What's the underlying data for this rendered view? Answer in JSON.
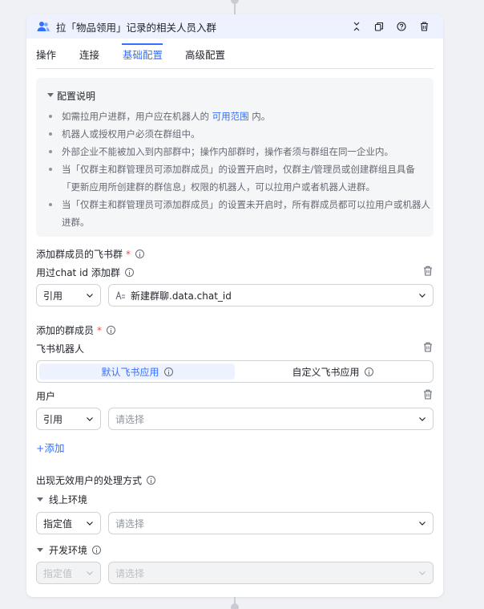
{
  "node": {
    "title": "拉「物品领用」记录的相关人员入群",
    "header_icons": [
      "collapse-icon",
      "copy-icon",
      "help-icon",
      "delete-icon"
    ]
  },
  "tabs": [
    {
      "label": "操作",
      "active": false
    },
    {
      "label": "连接",
      "active": false
    },
    {
      "label": "基础配置",
      "active": true
    },
    {
      "label": "高级配置",
      "active": false
    }
  ],
  "notes": {
    "title": "配置说明",
    "items": [
      {
        "text": "如需拉用户进群，用户应在机器人的 ",
        "link": "可用范围",
        "suffix": " 内。"
      },
      {
        "text": "机器人或授权用户必须在群组中。"
      },
      {
        "text": "外部企业不能被加入到内部群中；操作内部群时，操作者须与群组在同一企业内。"
      },
      {
        "text": "当「仅群主和群管理员可添加群成员」的设置开启时，仅群主/管理员或创建群组且具备「更新应用所创建群的群信息」权限的机器人，可以拉用户或者机器人进群。"
      },
      {
        "text": "当「仅群主和群管理员可添加群成员」的设置未开启时，所有群成员都可以拉用户或机器人进群。"
      }
    ]
  },
  "target_group": {
    "label": "添加群成员的飞书群",
    "required": "*",
    "sub_label": "用过chat id 添加群",
    "mode": "引用",
    "value_icon": "text-variable-icon",
    "value": "新建群聊.data.chat_id"
  },
  "members": {
    "label": "添加的群成员",
    "required": "*",
    "bot": {
      "label": "飞书机器人",
      "options": [
        "默认飞书应用",
        "自定义飞书应用"
      ],
      "selected": "默认飞书应用"
    },
    "user": {
      "label": "用户",
      "mode": "引用",
      "placeholder": "请选择"
    },
    "add_label": "+添加"
  },
  "invalid_users": {
    "label": "出现无效用户的处理方式",
    "online": {
      "label": "线上环境",
      "mode": "指定值",
      "placeholder": "请选择"
    },
    "dev": {
      "label": "开发环境",
      "mode": "指定值",
      "placeholder": "请选择",
      "disabled": true
    }
  },
  "colors": {
    "accent": "#3370ff",
    "required": "#f54a45",
    "header_bg": "#eef2ff"
  }
}
